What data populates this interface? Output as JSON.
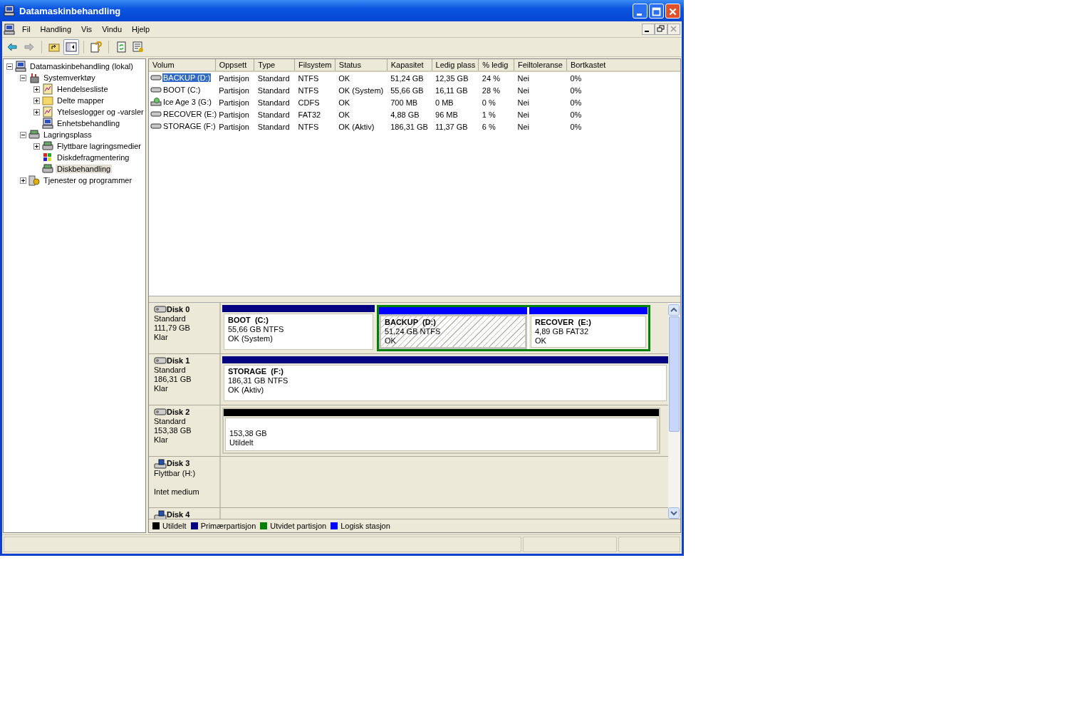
{
  "window": {
    "title": "Datamaskinbehandling"
  },
  "menu": [
    "Fil",
    "Handling",
    "Vis",
    "Vindu",
    "Hjelp"
  ],
  "tree": [
    {
      "label": "Datamaskinbehandling (lokal)",
      "selected": false,
      "expanded": true,
      "children": [
        {
          "label": "Systemverktøy",
          "selected": false,
          "expanded": true,
          "children": [
            {
              "label": "Hendelsesliste",
              "selected": false,
              "expanded": false
            },
            {
              "label": "Delte mapper",
              "selected": false,
              "expanded": false
            },
            {
              "label": "Ytelseslogger og -varsler",
              "selected": false,
              "expanded": false
            },
            {
              "label": "Enhetsbehandling",
              "selected": false
            }
          ]
        },
        {
          "label": "Lagringsplass",
          "selected": false,
          "expanded": true,
          "children": [
            {
              "label": "Flyttbare lagringsmedier",
              "selected": false,
              "expanded": false
            },
            {
              "label": "Diskdefragmentering",
              "selected": false
            },
            {
              "label": "Diskbehandling",
              "selected": true
            }
          ]
        },
        {
          "label": "Tjenester og programmer",
          "selected": false,
          "expanded": false
        }
      ]
    }
  ],
  "table": {
    "columns": [
      "Volum",
      "Oppsett",
      "Type",
      "Filsystem",
      "Status",
      "Kapasitet",
      "Ledig plass",
      "% ledig",
      "Feiltoleranse",
      "Bortkastet"
    ],
    "rows": [
      {
        "kind": "disk",
        "selected": true,
        "cells": [
          "BACKUP (D:)",
          "Partisjon",
          "Standard",
          "NTFS",
          "OK",
          "51,24 GB",
          "12,35 GB",
          "24 %",
          "Nei",
          "0%"
        ]
      },
      {
        "kind": "disk",
        "selected": false,
        "cells": [
          "BOOT (C:)",
          "Partisjon",
          "Standard",
          "NTFS",
          "OK (System)",
          "55,66 GB",
          "16,11 GB",
          "28 %",
          "Nei",
          "0%"
        ]
      },
      {
        "kind": "cd",
        "selected": false,
        "cells": [
          "Ice Age 3 (G:)",
          "Partisjon",
          "Standard",
          "CDFS",
          "OK",
          "700 MB",
          "0 MB",
          "0 %",
          "Nei",
          "0%"
        ]
      },
      {
        "kind": "disk",
        "selected": false,
        "cells": [
          "RECOVER (E:)",
          "Partisjon",
          "Standard",
          "FAT32",
          "OK",
          "4,88 GB",
          "96 MB",
          "1 %",
          "Nei",
          "0%"
        ]
      },
      {
        "kind": "disk",
        "selected": false,
        "cells": [
          "STORAGE (F:)",
          "Partisjon",
          "Standard",
          "NTFS",
          "OK (Aktiv)",
          "186,31 GB",
          "11,37 GB",
          "6 %",
          "Nei",
          "0%"
        ]
      }
    ]
  },
  "disks": [
    {
      "name": "Disk 0",
      "kind": "fixed",
      "info": [
        "Standard",
        "111,79 GB"
      ],
      "status": "Klar",
      "partitions": [
        {
          "kind": "primary",
          "selected": false,
          "name": "BOOT  (C:)",
          "detail": "55,66 GB NTFS",
          "status": "OK (System)"
        },
        {
          "kind": "extended",
          "children": [
            {
              "kind": "logical",
              "selected": true,
              "name": "BACKUP  (D:)",
              "detail": "51,24 GB NTFS",
              "status": "OK"
            },
            {
              "kind": "logical",
              "selected": false,
              "name": "RECOVER  (E:)",
              "detail": "4,89 GB FAT32",
              "status": "OK"
            }
          ]
        }
      ]
    },
    {
      "name": "Disk 1",
      "kind": "fixed",
      "info": [
        "Standard",
        "186,31 GB"
      ],
      "status": "Klar",
      "partitions": [
        {
          "kind": "primary",
          "selected": false,
          "name": "STORAGE  (F:)",
          "detail": "186,31 GB NTFS",
          "status": "OK (Aktiv)"
        }
      ]
    },
    {
      "name": "Disk 2",
      "kind": "fixed",
      "info": [
        "Standard",
        "153,38 GB"
      ],
      "status": "Klar",
      "partitions": [
        {
          "kind": "unallocated",
          "selected": false,
          "detail": "153,38 GB",
          "status": "Utildelt"
        }
      ]
    },
    {
      "name": "Disk 3",
      "kind": "removable",
      "info": [
        "Flyttbar (H:)"
      ],
      "status": "Intet medium"
    },
    {
      "name": "Disk 4",
      "kind": "removable"
    }
  ],
  "legend": [
    {
      "label": "Utildelt",
      "color": "#000000"
    },
    {
      "label": "Primærpartisjon",
      "color": "#000080"
    },
    {
      "label": "Utvidet partisjon",
      "color": "#008000"
    },
    {
      "label": "Logisk stasjon",
      "color": "#0000ff"
    }
  ]
}
